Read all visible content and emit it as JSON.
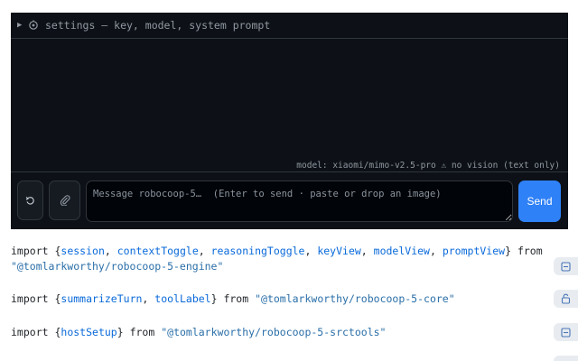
{
  "settings": {
    "label": "settings — key, model, system prompt"
  },
  "status": {
    "model_line": "model: xiaomi/mimo-v2.5-pro ⚠ no vision (text only)"
  },
  "composer": {
    "placeholder": "Message robocoop-5…  (Enter to send · paste or drop an image)",
    "send_label": "Send"
  },
  "imports": [
    {
      "keyword": "import",
      "names": [
        "session",
        "contextToggle",
        "reasoningToggle",
        "keyView",
        "modelView",
        "promptView"
      ],
      "from": "from",
      "source": "\"@tomlarkworthy/robocoop-5-engine\""
    },
    {
      "keyword": "import",
      "names": [
        "summarizeTurn",
        "toolLabel"
      ],
      "from": "from",
      "source": "\"@tomlarkworthy/robocoop-5-core\""
    },
    {
      "keyword": "import",
      "names": [
        "hostSetup"
      ],
      "from": "from",
      "source": "\"@tomlarkworthy/robocoop-5-srctools\""
    }
  ],
  "icons": {
    "settings": "gear-icon",
    "reset": "reset-icon",
    "attach": "paperclip-icon",
    "toggle_collapse": "collapse-icon",
    "toggle_unlocked": "unlock-icon"
  },
  "colors": {
    "panel_bg": "#0d1117",
    "send_bg": "#2f81f7",
    "identifier": "#0969da"
  }
}
